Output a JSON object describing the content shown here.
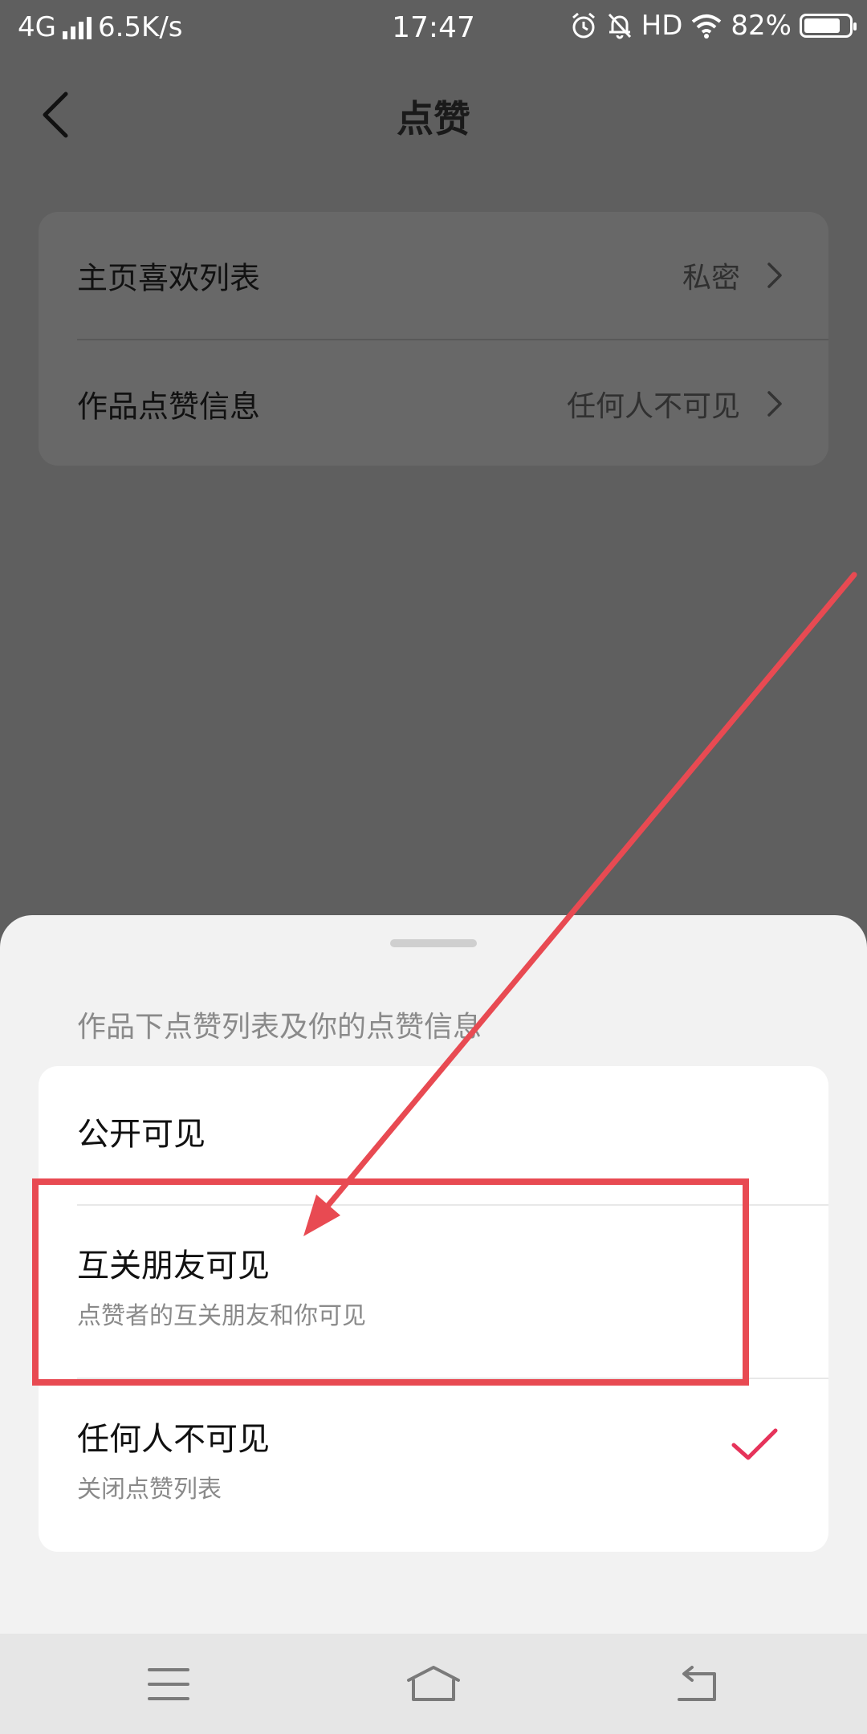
{
  "status_bar": {
    "network": "4G",
    "speed": "6.5K/s",
    "time": "17:47",
    "hd": "HD",
    "battery_text": "82%",
    "battery_level": 0.82
  },
  "header": {
    "title": "点赞"
  },
  "settings": [
    {
      "label": "主页喜欢列表",
      "value": "私密"
    },
    {
      "label": "作品点赞信息",
      "value": "任何人不可见"
    }
  ],
  "sheet": {
    "title": "作品下点赞列表及你的点赞信息",
    "options": [
      {
        "label": "公开可见",
        "desc": ""
      },
      {
        "label": "互关朋友可见",
        "desc": "点赞者的互关朋友和你可见"
      },
      {
        "label": "任何人不可见",
        "desc": "关闭点赞列表",
        "selected": true
      }
    ]
  },
  "colors": {
    "accent": "#e6335a",
    "annotation": "#e84a52"
  }
}
